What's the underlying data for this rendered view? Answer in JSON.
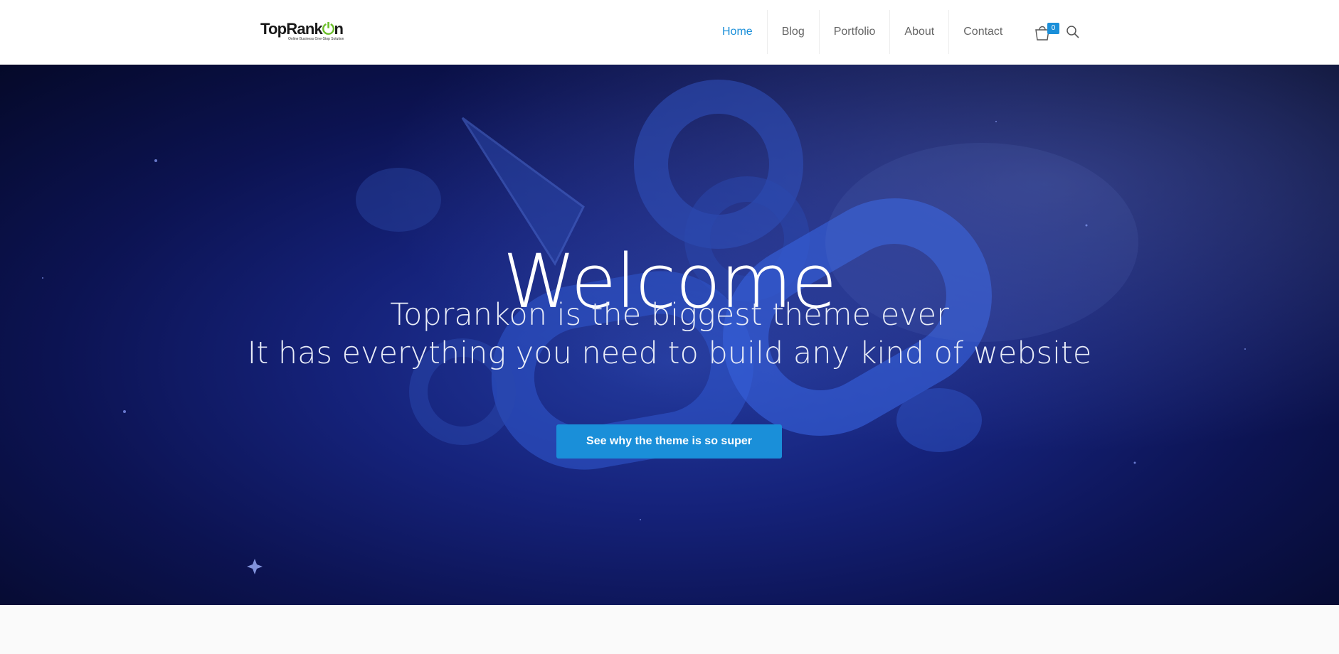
{
  "header": {
    "logo": {
      "text_prefix": "Top",
      "text_mid": "Rank",
      "text_suffix": "On",
      "tagline": "Online Business One-Stop Solution"
    },
    "nav": [
      {
        "label": "Home",
        "active": true
      },
      {
        "label": "Blog",
        "active": false
      },
      {
        "label": "Portfolio",
        "active": false
      },
      {
        "label": "About",
        "active": false
      },
      {
        "label": "Contact",
        "active": false
      }
    ],
    "cart": {
      "icon": "shopping-bag-icon",
      "count": "0"
    },
    "search": {
      "icon": "search-icon"
    }
  },
  "hero": {
    "title": "Welcome",
    "subtitle_line1": "Toprankon is the biggest theme ever",
    "subtitle_line2": "It has everything you need to build any kind of website",
    "cta_label": "See why the theme is so super"
  },
  "colors": {
    "accent": "#1a8fd9",
    "logo_green": "#6cbf2a",
    "hero_dark": "#050929",
    "hero_mid": "#15227a"
  }
}
